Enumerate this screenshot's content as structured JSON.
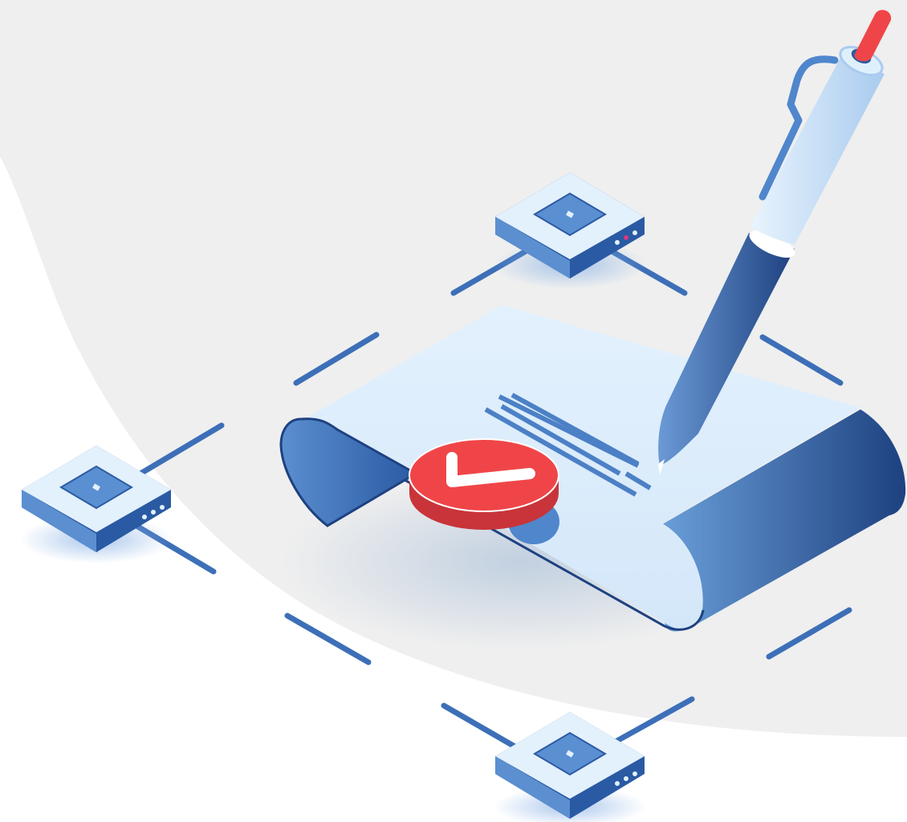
{
  "illustration": {
    "subject": "signed-contract-network",
    "elements": [
      "document-scroll",
      "check-seal",
      "pen",
      "node-device-top",
      "node-device-left",
      "node-device-bottom",
      "connector-lines"
    ]
  },
  "colors": {
    "background_gray": "#efefef",
    "background_white": "#ffffff",
    "paper_light": "#dfeefb",
    "roll_dark": "#1e4180",
    "roll_light": "#5b8fd0",
    "line_blue": "#3d6fb8",
    "seal_red": "#f04548",
    "seal_red_dark": "#c8343a",
    "pen_tip_red": "#f04548",
    "device_top": "#e3f1fd",
    "device_inner": "#5a8fd2",
    "device_inner_dark": "#2d5aa3",
    "shadow_blue": "#bcd3ef"
  }
}
